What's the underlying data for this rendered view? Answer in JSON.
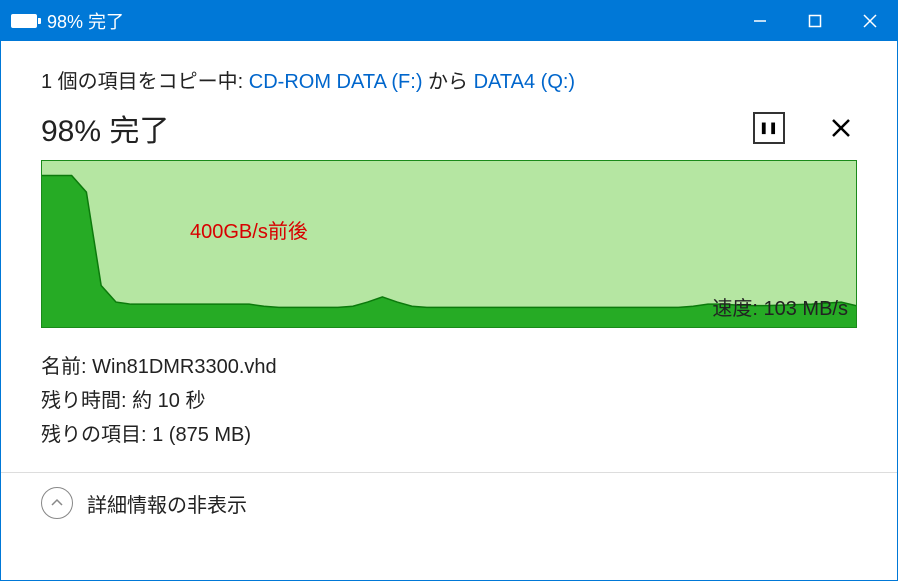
{
  "window": {
    "battery_fill_pct": 98,
    "title": "98% 完了"
  },
  "copy": {
    "prefix": "1 個の項目をコピー中: ",
    "source": "CD-ROM DATA (F:)",
    "mid": " から ",
    "dest": "DATA4 (Q:)"
  },
  "progress": {
    "text": "98% 完了"
  },
  "chart_data": {
    "type": "area",
    "xlabel": "",
    "ylabel": "",
    "ylim": [
      0,
      800
    ],
    "values": [
      730,
      730,
      730,
      650,
      200,
      120,
      110,
      110,
      110,
      110,
      110,
      110,
      110,
      110,
      110,
      100,
      95,
      95,
      95,
      95,
      95,
      100,
      120,
      145,
      120,
      100,
      95,
      95,
      95,
      95,
      95,
      95,
      95,
      95,
      95,
      95,
      95,
      95,
      95,
      95,
      95,
      95,
      95,
      95,
      100,
      110,
      110,
      105,
      103,
      103,
      105,
      108,
      110,
      115,
      120,
      103
    ],
    "annotation": {
      "label": "400GB/s前後",
      "color": "#d80000"
    },
    "speed_label": "速度: 103 MB/s",
    "colors": {
      "fill": "#1fa81f",
      "bg": "#b5e6a2",
      "border": "#1a8a1a"
    }
  },
  "details": {
    "name_label": "名前: ",
    "name_value": "Win81DMR3300.vhd",
    "time_label": "残り時間: ",
    "time_value": "約 10 秒",
    "items_label": "残りの項目: ",
    "items_value": "1 (875 MB)"
  },
  "toggle": {
    "label": "詳細情報の非表示"
  }
}
